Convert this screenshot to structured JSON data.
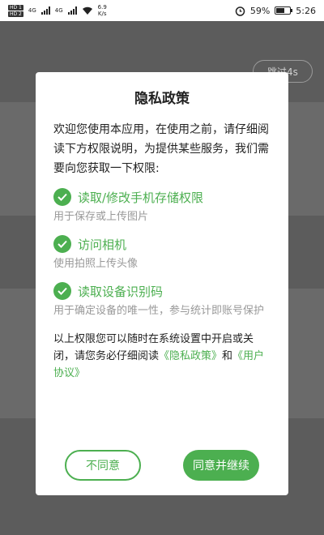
{
  "status_bar": {
    "sim1": "HD 1",
    "sim2": "HD 2",
    "net1": "4G",
    "net2": "4G",
    "speed_value": "6.9",
    "speed_unit": "K/s",
    "battery_percent": "59%",
    "battery_level": 0.59,
    "time": "5:26"
  },
  "background": {
    "skip_label": "跳过4s"
  },
  "dialog": {
    "title": "隐私政策",
    "intro": "欢迎您使用本应用，在使用之前，请仔细阅读下方权限说明，为提供某些服务，我们需要向您获取一下权限:",
    "permissions": [
      {
        "title": "读取/修改手机存储权限",
        "desc": "用于保存或上传图片"
      },
      {
        "title": "访问相机",
        "desc": "使用拍照上传头像"
      },
      {
        "title": "读取设备识别码",
        "desc": "用于确定设备的唯一性，参与统计即账号保护"
      }
    ],
    "footer": {
      "prefix": "以上权限您可以随时在系统设置中开启或关闭，请您务必仔细阅读",
      "privacy_link": "《隐私政策》",
      "and": "和",
      "agreement_link": "《用户协议》"
    },
    "buttons": {
      "disagree": "不同意",
      "agree": "同意并继续"
    }
  },
  "colors": {
    "accent": "#4caf50",
    "desc_text": "#999999",
    "overlay": "#5c5c5c"
  }
}
